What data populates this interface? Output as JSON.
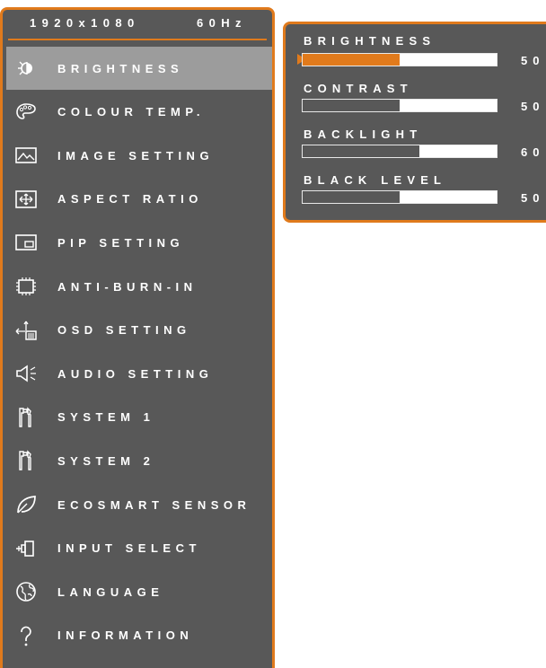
{
  "status": {
    "resolution": "1920x1080",
    "refresh": "60Hz"
  },
  "colors": {
    "accent": "#e07a1c",
    "panel": "#585858",
    "selected_row": "#9c9c9c",
    "track": "#ffffff"
  },
  "menu": {
    "items": [
      {
        "label": "BRIGHTNESS",
        "icon": "brightness-icon",
        "selected": true
      },
      {
        "label": "COLOUR TEMP.",
        "icon": "palette-icon"
      },
      {
        "label": "IMAGE SETTING",
        "icon": "image-icon"
      },
      {
        "label": "ASPECT RATIO",
        "icon": "aspect-ratio-icon"
      },
      {
        "label": "PIP SETTING",
        "icon": "pip-icon"
      },
      {
        "label": "ANTI-BURN-IN",
        "icon": "chip-icon"
      },
      {
        "label": "OSD SETTING",
        "icon": "osd-icon"
      },
      {
        "label": "AUDIO SETTING",
        "icon": "speaker-icon"
      },
      {
        "label": "SYSTEM 1",
        "icon": "tools-icon"
      },
      {
        "label": "SYSTEM 2",
        "icon": "tools-icon"
      },
      {
        "label": "ECOSMART SENSOR",
        "icon": "leaf-icon"
      },
      {
        "label": "INPUT SELECT",
        "icon": "plug-icon"
      },
      {
        "label": "LANGUAGE",
        "icon": "globe-icon"
      },
      {
        "label": "INFORMATION",
        "icon": "question-icon"
      }
    ]
  },
  "submenu": {
    "title": "BRIGHTNESS",
    "sliders": [
      {
        "label": "BRIGHTNESS",
        "value": "50",
        "level": 0.5,
        "active": true
      },
      {
        "label": "CONTRAST",
        "value": "50",
        "level": 0.5
      },
      {
        "label": "BACKLIGHT",
        "value": "60",
        "level": 0.6
      },
      {
        "label": "BLACK LEVEL",
        "value": "50",
        "level": 0.5
      }
    ]
  }
}
